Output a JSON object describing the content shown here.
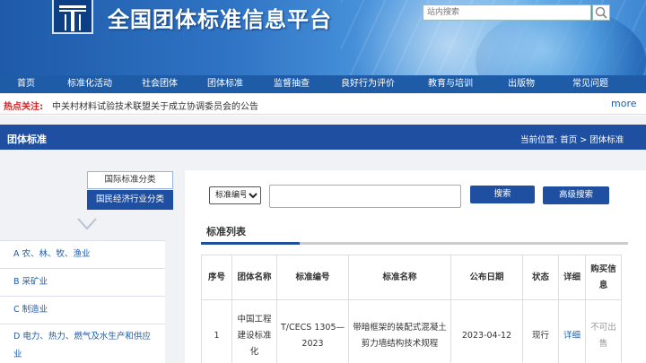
{
  "header": {
    "site_title": "全国团体标准信息平台",
    "search_placeholder": "站内搜索",
    "search_icon": "search-icon"
  },
  "nav": {
    "items": [
      "首页",
      "标准化活动",
      "社会团体",
      "团体标准",
      "监督抽查",
      "良好行为评价",
      "教育与培训",
      "出版物",
      "常见问题"
    ]
  },
  "hotbar": {
    "label": "热点关注:",
    "text": "中关村材料试验技术联盟关于成立协调委员会的公告",
    "more": "more"
  },
  "section": {
    "title": "团体标准",
    "location_label": "当前位置:",
    "location_home": "首页",
    "location_sep": ">",
    "location_current": "团体标准"
  },
  "sidebar": {
    "tab_intl": "国际标准分类",
    "tab_econ": "国民经济行业分类",
    "categories": [
      "A 农、林、牧、渔业",
      "B 采矿业",
      "C 制造业",
      "D 电力、热力、燃气及水生产和供应业"
    ]
  },
  "search": {
    "select_value": "标准编号",
    "keyword_value": "",
    "search_button": "搜索",
    "advanced_button": "高级搜索"
  },
  "list": {
    "title": "标准列表",
    "headers": [
      "序号",
      "团体名称",
      "标准编号",
      "标准名称",
      "公布日期",
      "状态",
      "详细",
      "购买信息"
    ],
    "rows": [
      {
        "index": "1",
        "org": "中国工程建设标准化",
        "code": "T/CECS 1305—2023",
        "name": "带暗框架的装配式混凝土剪力墙结构技术规程",
        "date": "2023-04-12",
        "status": "现行",
        "detail": "详细",
        "purchase": "不可出售"
      }
    ]
  },
  "colors": {
    "nav_blue": "#1f5ca8",
    "section_blue": "#1f4fa0",
    "hot_red": "#dd2222",
    "link_blue": "#1f5ca8"
  }
}
